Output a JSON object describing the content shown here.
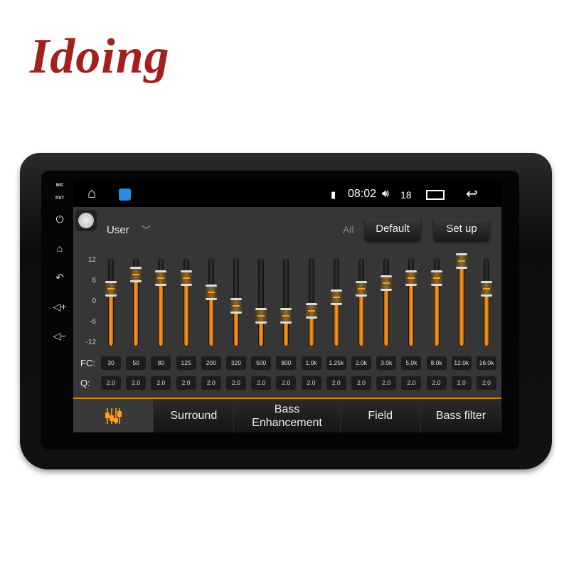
{
  "brand": "Idoing",
  "side_buttons": [
    {
      "label": "MIC"
    },
    {
      "label": "RST"
    }
  ],
  "side_icons": [
    "power-icon",
    "home-icon",
    "back-icon",
    "volume-up-icon",
    "volume-down-icon"
  ],
  "status": {
    "time": "08:02",
    "volume": "18"
  },
  "toolbar": {
    "preset": "User",
    "all": "All",
    "default": "Default",
    "setup": "Set up"
  },
  "eq": {
    "ticks": [
      "12",
      "6",
      "0",
      "-6",
      "-12"
    ],
    "range": [
      -12,
      12
    ],
    "fc_label": "FC:",
    "q_label": "Q:",
    "bands": [
      {
        "fc": "30",
        "q": "2.0",
        "gain": 4
      },
      {
        "fc": "50",
        "q": "2.0",
        "gain": 8
      },
      {
        "fc": "80",
        "q": "2.0",
        "gain": 7
      },
      {
        "fc": "125",
        "q": "2.0",
        "gain": 7
      },
      {
        "fc": "200",
        "q": "2.0",
        "gain": 3
      },
      {
        "fc": "320",
        "q": "2.0",
        "gain": -1
      },
      {
        "fc": "500",
        "q": "2.0",
        "gain": -4
      },
      {
        "fc": "800",
        "q": "2.0",
        "gain": -4
      },
      {
        "fc": "1.0k",
        "q": "2.0",
        "gain": -2.5
      },
      {
        "fc": "1.25k",
        "q": "2.0",
        "gain": 1.5
      },
      {
        "fc": "2.0k",
        "q": "2.0",
        "gain": 4
      },
      {
        "fc": "3.0k",
        "q": "2.0",
        "gain": 5.5
      },
      {
        "fc": "5.0k",
        "q": "2.0",
        "gain": 7
      },
      {
        "fc": "8.0k",
        "q": "2.0",
        "gain": 7
      },
      {
        "fc": "12.0k",
        "q": "2.0",
        "gain": 12
      },
      {
        "fc": "16.0k",
        "q": "2.0",
        "gain": 4
      }
    ],
    "accent": "#ffa020"
  },
  "tabs": [
    {
      "label": "",
      "icon": "equalizer-icon"
    },
    {
      "label": "Surround"
    },
    {
      "label": "Bass Enhancement"
    },
    {
      "label": "Field"
    },
    {
      "label": "Bass filter"
    }
  ]
}
